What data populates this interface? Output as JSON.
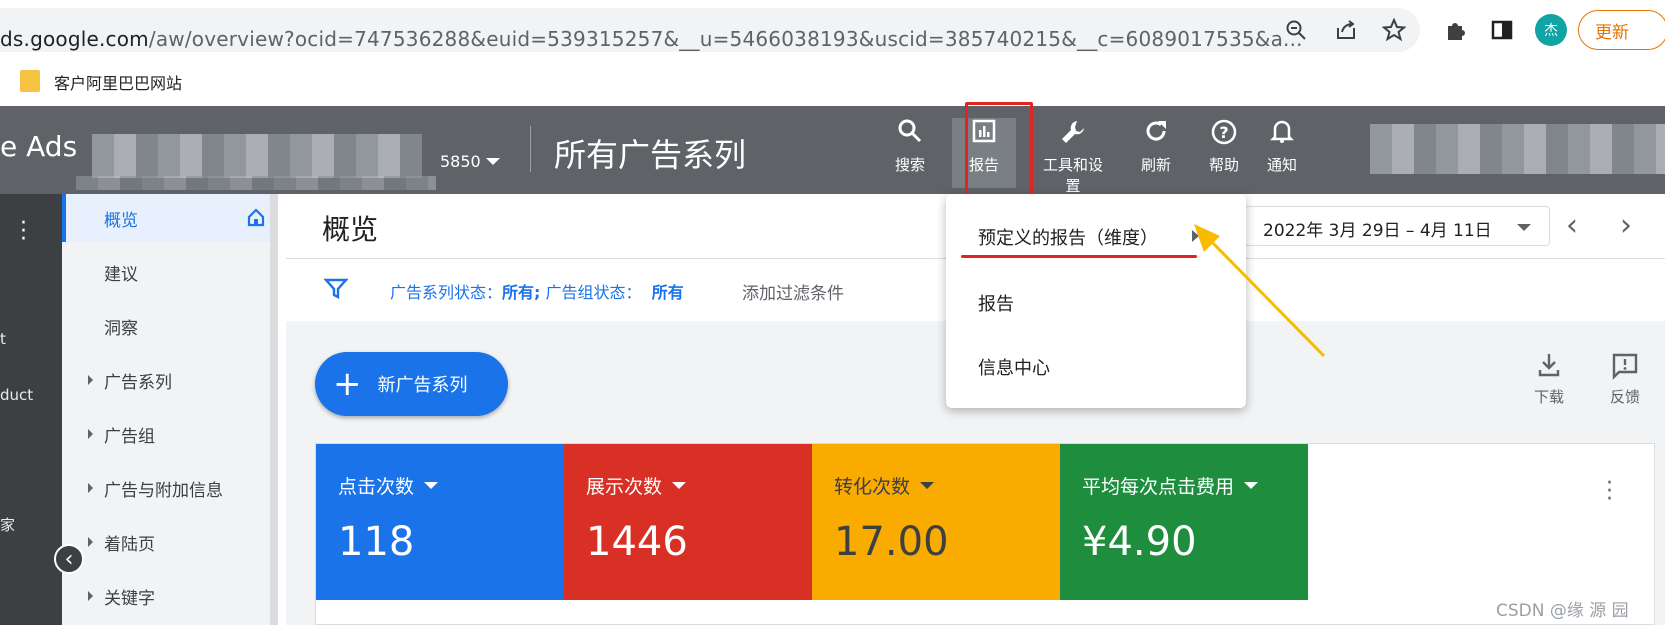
{
  "browser": {
    "url_host": "ds.google.com",
    "url_rest": "/aw/overview?ocid=747536288&euid=539315257&__u=5466038193&uscid=385740215&__c=6089017535&a...",
    "avatar_initial": "杰",
    "update_label": "更新",
    "bookmark_label": "客户阿里巴巴网站"
  },
  "header": {
    "logo_text": "e Ads",
    "account_suffix": "5850",
    "title": "所有广告系列",
    "tools": [
      {
        "label": "搜索",
        "icon": "search-icon"
      },
      {
        "label": "报告",
        "icon": "reports-icon"
      },
      {
        "label": "工具和设置",
        "icon": "wrench-icon"
      },
      {
        "label": "刷新",
        "icon": "refresh-icon"
      },
      {
        "label": "帮助",
        "icon": "help-icon"
      },
      {
        "label": "通知",
        "icon": "bell-icon"
      }
    ]
  },
  "rail": {
    "fragments": [
      "t",
      "duct",
      "家"
    ]
  },
  "nav": {
    "items": [
      {
        "label": "概览",
        "active": true
      },
      {
        "label": "建议"
      },
      {
        "label": "洞察"
      },
      {
        "label": "广告系列",
        "expandable": true
      },
      {
        "label": "广告组",
        "expandable": true
      },
      {
        "label": "广告与附加信息",
        "expandable": true
      },
      {
        "label": "着陆页",
        "expandable": true
      },
      {
        "label": "关键字",
        "expandable": true
      }
    ]
  },
  "main": {
    "page_title": "概览",
    "date_range": "2022年 3月 29日 – 4月 11日",
    "filter": {
      "campaign_status_label": "广告系列状态：",
      "campaign_status_value": "所有;",
      "adgroup_status_label": " 广告组状态：",
      "adgroup_status_value": "所有",
      "add_filter": "添加过滤条件"
    },
    "new_campaign_label": "新广告系列",
    "download_label": "下载",
    "feedback_label": "反馈",
    "metrics": [
      {
        "label": "点击次数",
        "value": "118",
        "color": "#1a73e8"
      },
      {
        "label": "展示次数",
        "value": "1446",
        "color": "#d93025"
      },
      {
        "label": "转化次数",
        "value": "17.00",
        "color": "#f9ab00"
      },
      {
        "label": "平均每次点击费用",
        "value": "¥4.90",
        "color": "#1e8e3e"
      }
    ]
  },
  "dropdown": {
    "items": [
      "预定义的报告（维度）",
      "报告",
      "信息中心"
    ]
  },
  "watermark": "CSDN @缘  源  园",
  "colors": {
    "header_bg": "#5f6368",
    "accent": "#1a73e8",
    "annotation_red": "#e02424",
    "annotation_arrow": "#f9bb00"
  }
}
